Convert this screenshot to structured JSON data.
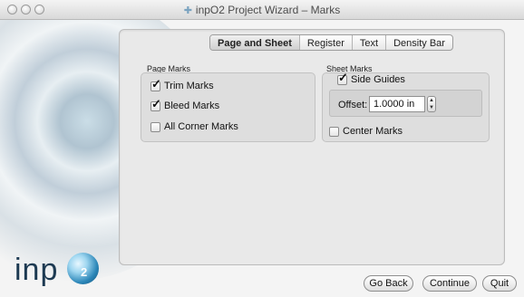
{
  "window": {
    "title": "inpO2 Project Wizard – Marks"
  },
  "tabs": [
    {
      "label": "Page and Sheet",
      "active": true
    },
    {
      "label": "Register",
      "active": false
    },
    {
      "label": "Text",
      "active": false
    },
    {
      "label": "Density Bar",
      "active": false
    }
  ],
  "page_marks": {
    "title": "Page Marks",
    "items": [
      {
        "label": "Trim Marks",
        "checked": true
      },
      {
        "label": "Bleed Marks",
        "checked": true
      },
      {
        "label": "All Corner Marks",
        "checked": false
      }
    ]
  },
  "sheet_marks": {
    "title": "Sheet Marks",
    "side_guides": {
      "label": "Side Guides",
      "checked": true
    },
    "offset": {
      "label": "Offset:",
      "value": "1.0000 in"
    },
    "center_marks": {
      "label": "Center Marks",
      "checked": false
    }
  },
  "logo": {
    "text": "inp",
    "sub": "2"
  },
  "buttons": {
    "go_back": "Go Back",
    "continue": "Continue",
    "quit": "Quit"
  },
  "colors": {
    "logo_text": "#1d3a52",
    "logo_orb": "#2b86b8"
  }
}
